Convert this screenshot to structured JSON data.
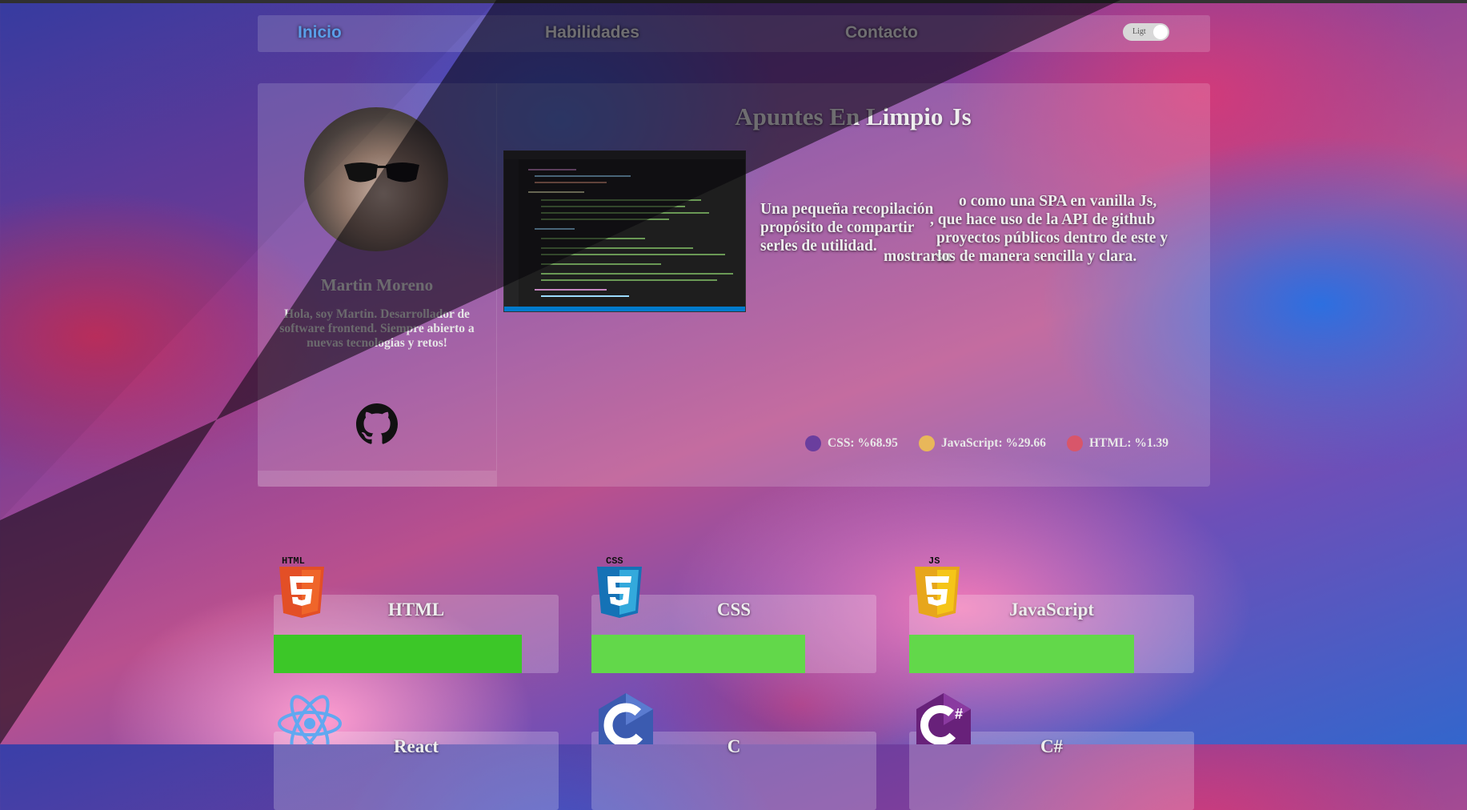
{
  "nav": {
    "items": [
      {
        "label": "Inicio",
        "active": true
      },
      {
        "label": "Habilidades",
        "active": false
      },
      {
        "label": "Contacto",
        "active": false
      }
    ],
    "theme_toggle_label": "Ligt"
  },
  "profile": {
    "name": "Martin Moreno",
    "bio": "Hola, soy Martin. Desarrollador de software frontend. Siempre abierto a nuevas tecnologias y retos!",
    "github_icon": "github-icon"
  },
  "project": {
    "title": "Apuntes En Limpio Js",
    "description": "Una pequeña recopilación... como una SPA en vanilla Js, propósito de compartir... que hace uso de la API de github serles de utilidad... proyectos públicos dentro de este y su mostrarlos de manera sencilla y clara.",
    "description_lines": [
      "Una pequeña recopilación",
      "propósito de compartir",
      "serles de utilidad."
    ],
    "description_right_lines": [
      "o como una SPA en vanilla Js,",
      ", que hace uso de la API de github",
      "proyectos públicos dentro de este y su",
      "mostrarlos de manera sencilla y clara."
    ],
    "languages": [
      {
        "label": "CSS: %68.95",
        "percent": 68.95,
        "color": "#563d7c"
      },
      {
        "label": "JavaScript: %29.66",
        "percent": 29.66,
        "color": "#f1e05a"
      },
      {
        "label": "HTML: %1.39",
        "percent": 1.39,
        "color": "#e34c26"
      }
    ]
  },
  "skills": [
    {
      "name": "HTML",
      "level_percent": 87,
      "icon": "html5-icon",
      "logo_text": "HTML"
    },
    {
      "name": "CSS",
      "level_percent": 75,
      "icon": "css3-icon",
      "logo_text": "CSS"
    },
    {
      "name": "JavaScript",
      "level_percent": 79,
      "icon": "javascript-icon",
      "logo_text": "JS"
    },
    {
      "name": "React",
      "icon": "react-icon"
    },
    {
      "name": "C",
      "icon": "c-icon"
    },
    {
      "name": "C#",
      "icon": "csharp-icon"
    }
  ]
}
